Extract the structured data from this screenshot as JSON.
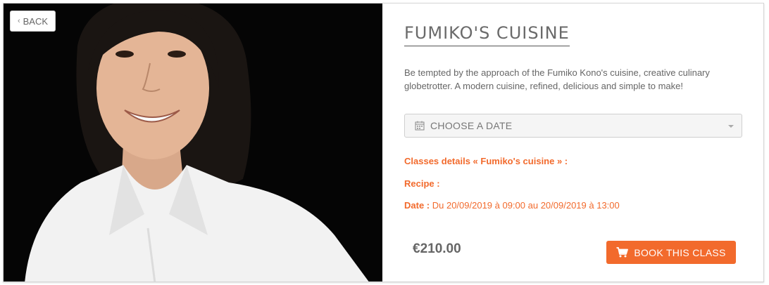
{
  "nav": {
    "back_label": "BACK"
  },
  "course": {
    "title": "FUMIKO'S CUISINE",
    "description": "Be tempted by the approach of the Fumiko Kono's cuisine, creative culinary globetrotter. A modern cuisine, refined, delicious and simple to make!",
    "date_select": {
      "placeholder": "CHOOSE A DATE",
      "icon": "calendar-icon"
    },
    "details": {
      "classes_label": "Classes details « Fumiko's cuisine » :",
      "recipe_label": "Recipe :",
      "date_label": "Date :",
      "date_value": " Du 20/09/2019 à 09:00 au 20/09/2019 à 13:00"
    },
    "price": "€210.00",
    "book_button": {
      "label": "BOOK THIS CLASS",
      "icon": "cart-icon"
    }
  },
  "colors": {
    "accent": "#f26a2c",
    "photo_background": "#050505"
  }
}
